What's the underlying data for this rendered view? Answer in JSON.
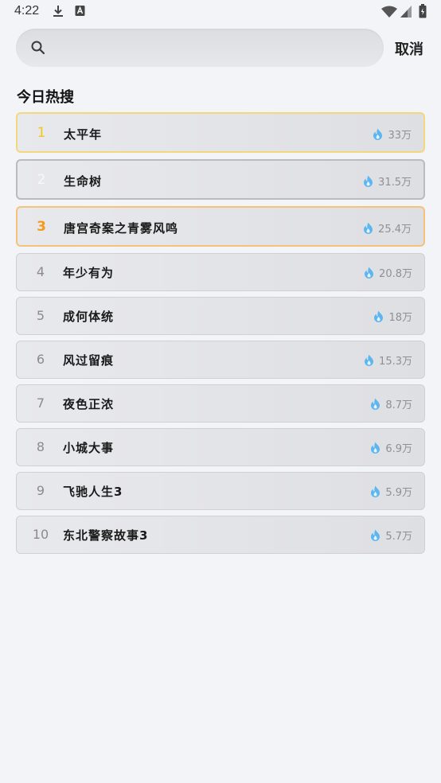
{
  "status_bar": {
    "time": "4:22",
    "icons": [
      "download-icon",
      "a-icon",
      "wifi-icon",
      "signal-icon",
      "battery-icon"
    ]
  },
  "search": {
    "placeholder": "",
    "value": "",
    "cancel_label": "取消"
  },
  "section": {
    "title": "今日热搜"
  },
  "colors": {
    "rank1": "#f5c518",
    "rank3": "#f39a18",
    "flame": "#5db6f0"
  },
  "hot_list": [
    {
      "rank": "1",
      "title": "太平年",
      "heat": "33万"
    },
    {
      "rank": "2",
      "title": "生命树",
      "heat": "31.5万"
    },
    {
      "rank": "3",
      "title": "唐宫奇案之青雾风鸣",
      "heat": "25.4万"
    },
    {
      "rank": "4",
      "title": "年少有为",
      "heat": "20.8万"
    },
    {
      "rank": "5",
      "title": "成何体统",
      "heat": "18万"
    },
    {
      "rank": "6",
      "title": "风过留痕",
      "heat": "15.3万"
    },
    {
      "rank": "7",
      "title": "夜色正浓",
      "heat": "8.7万"
    },
    {
      "rank": "8",
      "title": "小城大事",
      "heat": "6.9万"
    },
    {
      "rank": "9",
      "title": "飞驰人生3",
      "heat": "5.9万"
    },
    {
      "rank": "10",
      "title": "东北警察故事3",
      "heat": "5.7万"
    }
  ]
}
